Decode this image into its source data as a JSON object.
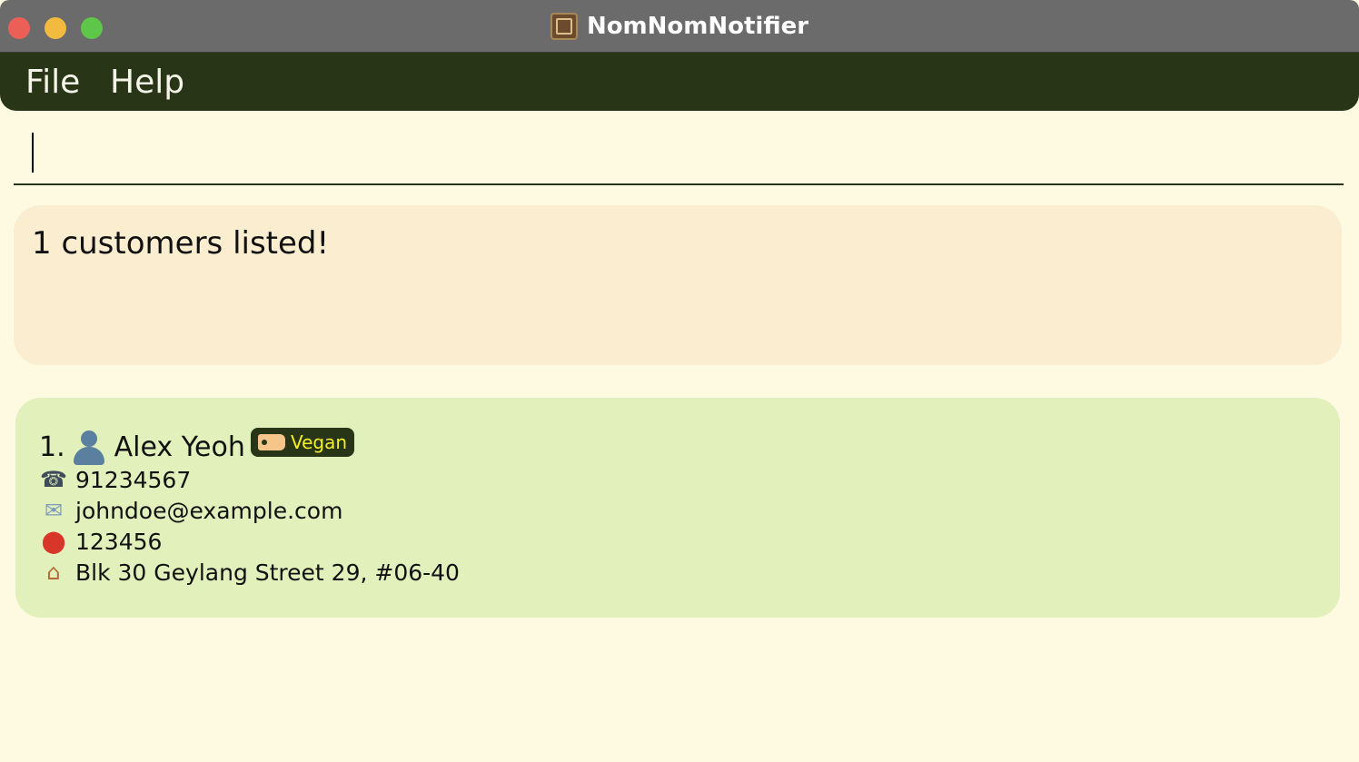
{
  "window": {
    "title": "NomNomNotifier",
    "app_icon": "nomnom-app-icon"
  },
  "menu": {
    "items": [
      {
        "label": "File"
      },
      {
        "label": "Help"
      }
    ]
  },
  "command_box": {
    "value": "",
    "placeholder": ""
  },
  "result_display": {
    "text": "1 customers listed!"
  },
  "customers": [
    {
      "index": "1.",
      "name": "Alex Yeoh",
      "tags": [
        "Vegan"
      ],
      "phone": "91234567",
      "email": "johndoe@example.com",
      "postal_code": "123456",
      "address": "Blk 30 Geylang Street 29, #06-40"
    }
  ],
  "icons": {
    "person": "person-icon",
    "tag": "tag-icon",
    "phone": "phone-icon",
    "email": "email-icon",
    "postal": "pin-icon",
    "address": "house-icon"
  },
  "colors": {
    "background": "#fef9e1",
    "menubar": "#283517",
    "result_box": "#faedd0",
    "card": "#e2f0bb",
    "tag_bg": "#283517",
    "tag_text": "#f5f02a"
  }
}
